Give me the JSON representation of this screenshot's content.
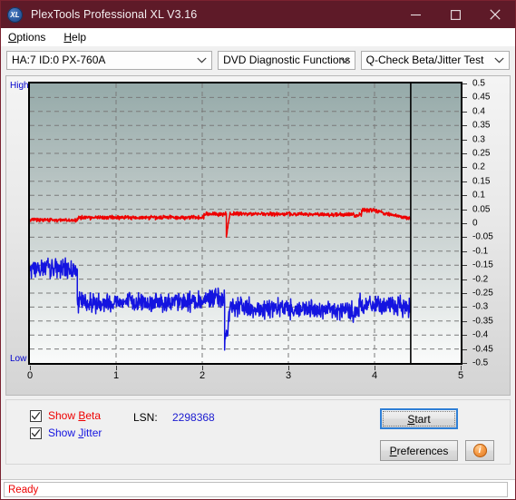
{
  "window": {
    "title": "PlexTools Professional XL V3.16",
    "icon": "XL",
    "controls": {
      "minimize": "minimize-icon",
      "maximize": "maximize-icon",
      "close": "close-icon"
    },
    "titlebar_color": "#5e1a28"
  },
  "menu": {
    "items": [
      {
        "label": "Options",
        "mnemonic": "O"
      },
      {
        "label": "Help",
        "mnemonic": "H"
      }
    ]
  },
  "toolbar": {
    "drive_select": "HA:7 ID:0  PX-760A",
    "function_group_select": "DVD Diagnostic Functions",
    "test_select": "Q-Check Beta/Jitter Test"
  },
  "chart_labels": {
    "high": "High",
    "low": "Low"
  },
  "bottom": {
    "show_beta_label": "Show Beta",
    "show_beta_mnemonic": "B",
    "show_beta_checked": true,
    "show_jitter_label": "Show Jitter",
    "show_jitter_mnemonic": "J",
    "show_jitter_checked": true,
    "lsn_label": "LSN:",
    "lsn_value": "2298368",
    "start_label": "Start",
    "start_mnemonic": "S",
    "preferences_label": "Preferences",
    "preferences_mnemonic": "P",
    "info_label": "i"
  },
  "status": {
    "text": "Ready"
  },
  "colors": {
    "beta_trace": "#ee0000",
    "jitter_trace": "#1414e0",
    "axis_label": "#0000cd",
    "accent": "#5e1a28",
    "status_text": "#ee0000"
  },
  "chart_data": {
    "type": "line",
    "title": "Q-Check Beta/Jitter Test",
    "xlabel": "",
    "ylabel": "",
    "xlim": [
      0,
      5
    ],
    "ylim": [
      -0.5,
      0.5
    ],
    "grid": true,
    "legend_position": "bottom-left",
    "x_ticks": [
      0,
      1,
      2,
      3,
      4,
      5
    ],
    "y_ticks": [
      0.5,
      0.45,
      0.4,
      0.35,
      0.3,
      0.25,
      0.2,
      0.15,
      0.1,
      0.05,
      0,
      -0.05,
      -0.1,
      -0.15,
      -0.2,
      -0.25,
      -0.3,
      -0.35,
      -0.4,
      -0.45,
      -0.5
    ],
    "y_tick_labels": [
      "0.5",
      "0.45",
      "0.4",
      "0.35",
      "0.3",
      "0.25",
      "0.2",
      "0.15",
      "0.1",
      "0.05",
      "0",
      "-0.05",
      "-0.1",
      "-0.15",
      "-0.2",
      "-0.25",
      "-0.3",
      "-0.35",
      "-0.4",
      "-0.45",
      "-0.5"
    ],
    "x_tick_labels": [
      "0",
      "1",
      "2",
      "3",
      "4",
      "5"
    ],
    "data_end_marker_x": 4.42,
    "series": [
      {
        "name": "Beta",
        "color": "#ee0000",
        "noise": 0.006,
        "segments": [
          {
            "x0": 0.0,
            "x1": 0.55,
            "y0": 0.012,
            "y1": 0.01
          },
          {
            "x0": 0.55,
            "x1": 2.02,
            "y0": 0.02,
            "y1": 0.021
          },
          {
            "x0": 2.02,
            "x1": 2.28,
            "y0": 0.033,
            "y1": 0.033
          },
          {
            "x0": 2.28,
            "x1": 2.32,
            "y0": -0.05,
            "y1": 0.033
          },
          {
            "x0": 2.32,
            "x1": 3.85,
            "y0": 0.034,
            "y1": 0.03
          },
          {
            "x0": 3.85,
            "x1": 4.0,
            "y0": 0.048,
            "y1": 0.046
          },
          {
            "x0": 4.0,
            "x1": 4.42,
            "y0": 0.045,
            "y1": 0.015
          }
        ]
      },
      {
        "name": "Jitter",
        "color": "#1414e0",
        "noise": 0.03,
        "segments": [
          {
            "x0": 0.0,
            "x1": 0.55,
            "y0": -0.16,
            "y1": -0.165
          },
          {
            "x0": 0.55,
            "x1": 2.02,
            "y0": -0.285,
            "y1": -0.28
          },
          {
            "x0": 2.02,
            "x1": 2.26,
            "y0": -0.26,
            "y1": -0.275
          },
          {
            "x0": 2.26,
            "x1": 2.33,
            "y0": -0.43,
            "y1": -0.3
          },
          {
            "x0": 2.33,
            "x1": 3.82,
            "y0": -0.3,
            "y1": -0.318
          },
          {
            "x0": 3.82,
            "x1": 4.42,
            "y0": -0.29,
            "y1": -0.3
          }
        ]
      }
    ]
  }
}
